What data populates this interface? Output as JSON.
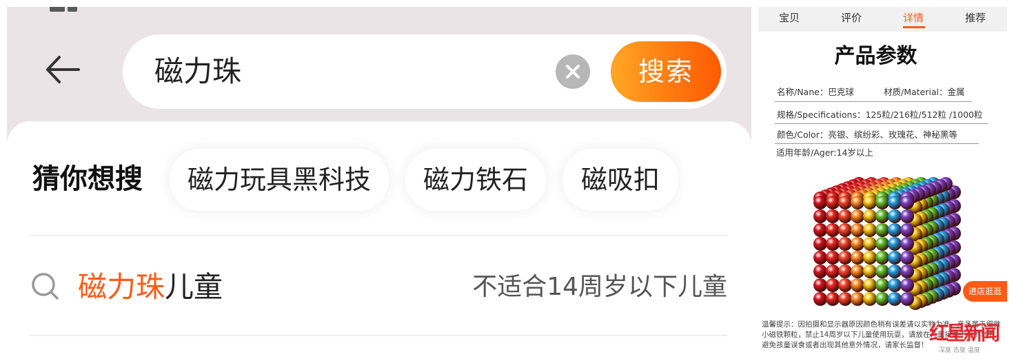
{
  "search_page": {
    "query": "磁力珠",
    "search_button_label": "搜索",
    "guess_title": "猜你想搜",
    "chips": [
      "磁力玩具黑科技",
      "磁力铁石",
      "磁吸扣"
    ],
    "suggestion": {
      "highlight": "磁力珠",
      "rest": "儿童",
      "warning": "不适合14周岁以下儿童"
    },
    "accent_color": "#ff5b16"
  },
  "product_page": {
    "tabs": [
      "宝贝",
      "评价",
      "详情",
      "推荐"
    ],
    "active_tab": "详情",
    "title": "产品参数",
    "specs": {
      "name": "名称/Nane：巴克球",
      "material": "材质/Material：金属",
      "size": "规格/Specifications：125粒/216粒/512粒 /1000粒",
      "color": "颜色/Color：亮银、缤纷彩、玫瑰花、神秘黑等",
      "age": "适用年龄/Ager:14岁以上"
    },
    "shop_button": "进店逛逛",
    "notice": "温馨提示：因拍摄和显示器原因颜色稍有误差请以实物为准，产品属于细微小磁铁颗粒，禁止14周岁以下儿童使用玩耍，请放在儿童接触不到的地方，避免孩童误食或者出现其他意外情况，请家长监督！",
    "watermark": "红星新闻",
    "watermark_slogan": "深度 态度 温度"
  }
}
